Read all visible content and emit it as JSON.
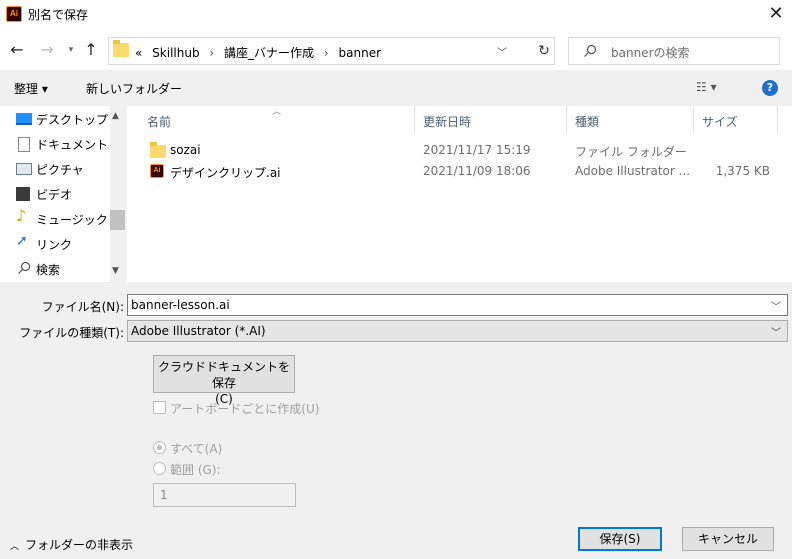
{
  "window": {
    "title": "別名で保存",
    "app_icon_text": "Ai",
    "close_symbol": "✕"
  },
  "nav": {
    "path": [
      "«",
      "Skillhub",
      "講座_バナー作成",
      "banner"
    ],
    "path_separator": "›",
    "search_placeholder": "bannerの検索"
  },
  "toolbar": {
    "organize_label": "整理 ▾",
    "new_folder_label": "新しいフォルダー",
    "help_symbol": "?"
  },
  "sidebar": {
    "items": [
      {
        "label": "デスクトップ",
        "icon": "desktop-icon"
      },
      {
        "label": "ドキュメント",
        "icon": "documents-icon"
      },
      {
        "label": "ピクチャ",
        "icon": "pictures-icon"
      },
      {
        "label": "ビデオ",
        "icon": "videos-icon"
      },
      {
        "label": "ミュージック",
        "icon": "music-icon"
      },
      {
        "label": "リンク",
        "icon": "links-icon"
      },
      {
        "label": "検索",
        "icon": "search-icon"
      }
    ]
  },
  "filelist": {
    "columns": [
      "名前",
      "更新日時",
      "種類",
      "サイズ"
    ],
    "rows": [
      {
        "name": "sozai",
        "date": "2021/11/17 15:19",
        "type": "ファイル フォルダー",
        "size": "",
        "icon": "folder-icon"
      },
      {
        "name": "デザインクリップ.ai",
        "date": "2021/11/09 18:06",
        "type": "Adobe Illustrator ...",
        "size": "1,375 KB",
        "icon": "ai-file-icon"
      }
    ]
  },
  "form": {
    "filename_label": "ファイル名(N):",
    "filename_value": "banner-lesson.ai",
    "filetype_label": "ファイルの種類(T):",
    "filetype_value": "Adobe Illustrator (*.AI)",
    "cloud_button_line1": "クラウドドキュメントを保存",
    "cloud_button_line2": "(C)",
    "artboard_checkbox_label": "アートボードごとに作成(U)",
    "all_radio_label": "すべて(A)",
    "range_radio_label": "範囲 (G):",
    "range_value": "1"
  },
  "footer": {
    "hide_folders_label": "フォルダーの非表示",
    "save_label": "保存(S)",
    "cancel_label": "キャンセル"
  },
  "colors": {
    "accent": "#0078d7",
    "help_blue": "#1a6fd1",
    "folder_yellow": "#fcd96b",
    "ai_orange": "#ff9a00"
  }
}
